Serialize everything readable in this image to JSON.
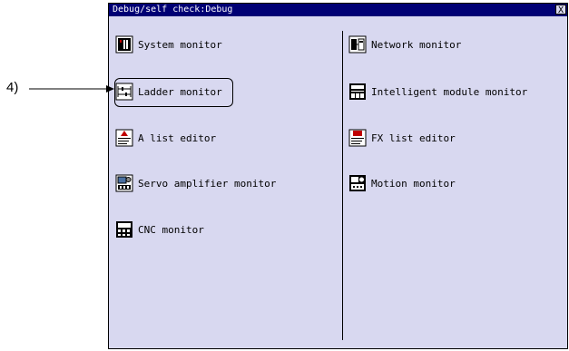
{
  "window": {
    "title": "Debug/self check:Debug",
    "close_label": "X"
  },
  "callout": {
    "label": "4)"
  },
  "menu": {
    "left": [
      {
        "label": "System monitor",
        "icon": "system-monitor-icon"
      },
      {
        "label": "Ladder monitor",
        "icon": "ladder-monitor-icon"
      },
      {
        "label": "A list editor",
        "icon": "a-list-editor-icon"
      },
      {
        "label": "Servo amplifier monitor",
        "icon": "servo-amplifier-monitor-icon"
      },
      {
        "label": "CNC monitor",
        "icon": "cnc-monitor-icon"
      }
    ],
    "right": [
      {
        "label": "Network monitor",
        "icon": "network-monitor-icon"
      },
      {
        "label": "Intelligent module monitor",
        "icon": "intelligent-module-monitor-icon"
      },
      {
        "label": "FX list editor",
        "icon": "fx-list-editor-icon"
      },
      {
        "label": "Motion monitor",
        "icon": "motion-monitor-icon"
      }
    ]
  },
  "colors": {
    "window_bg": "#d8d8f0",
    "title_bg": "#000074",
    "title_fg": "#ffffff"
  }
}
